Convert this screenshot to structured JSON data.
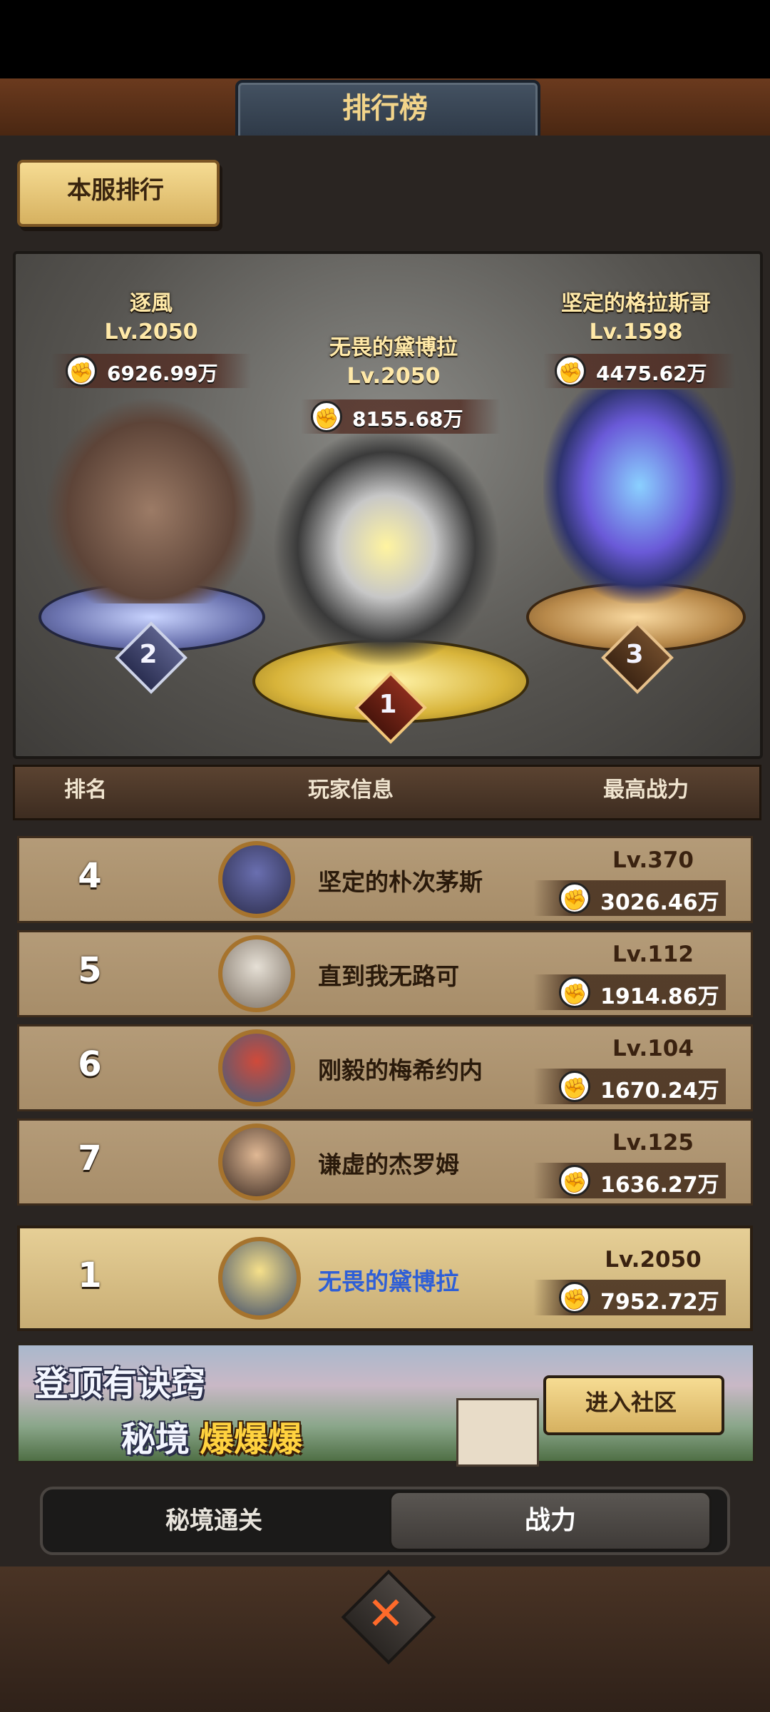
{
  "header": {
    "title": "排行榜"
  },
  "tab_server": {
    "label": "本服排行"
  },
  "podium": [
    {
      "rank": "2",
      "name": "逐風",
      "level": "Lv.2050",
      "power": "6926.99万"
    },
    {
      "rank": "1",
      "name": "无畏的黛博拉",
      "level": "Lv.2050",
      "power": "8155.68万"
    },
    {
      "rank": "3",
      "name": "坚定的格拉斯哥",
      "level": "Lv.1598",
      "power": "4475.62万"
    }
  ],
  "columns": {
    "rank": "排名",
    "player": "玩家信息",
    "power": "最高战力"
  },
  "rows": [
    {
      "rank": "4",
      "name": "坚定的朴次茅斯",
      "level": "Lv.370",
      "power": "3026.46万"
    },
    {
      "rank": "5",
      "name": "直到我无路可",
      "level": "Lv.112",
      "power": "1914.86万"
    },
    {
      "rank": "6",
      "name": "刚毅的梅希约内",
      "level": "Lv.104",
      "power": "1670.24万"
    },
    {
      "rank": "7",
      "name": "谦虚的杰罗姆",
      "level": "Lv.125",
      "power": "1636.27万"
    }
  ],
  "me": {
    "rank": "1",
    "name": "无畏的黛博拉",
    "level": "Lv.2050",
    "power": "7952.72万"
  },
  "banner": {
    "line1": "登顶有诀窍",
    "line2a": "秘境",
    "line2b": "爆爆爆",
    "button": "进入社区"
  },
  "bottom_tabs": {
    "secret": "秘境通关",
    "power": "战力"
  },
  "icons": {
    "power": "fist-icon",
    "close": "close-icon"
  },
  "colors": {
    "accent_gold": "#f6dc93",
    "self_name": "#2f5fd6",
    "close_x": "#ff6a2a"
  }
}
